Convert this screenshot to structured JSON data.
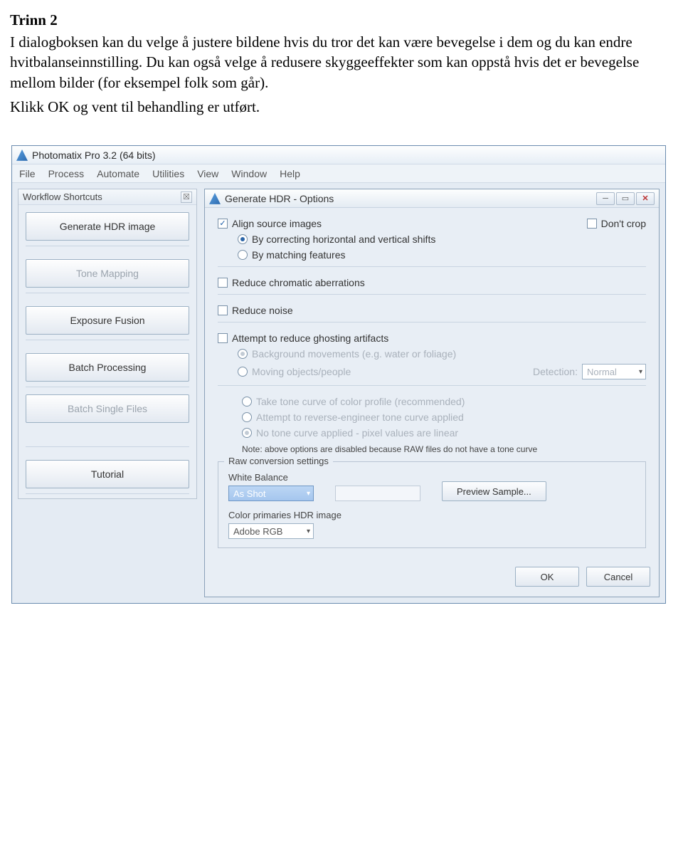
{
  "doc": {
    "heading": "Trinn 2",
    "para1": "I dialogboksen kan du velge å justere bildene hvis du tror det kan være bevegelse i dem og du kan endre hvitbalanseinnstilling. Du kan også velge å redusere skyggeeffekter som kan oppstå hvis det er bevegelse mellom bilder (for eksempel folk som går).",
    "para2": "Klikk OK og vent til behandling er utført."
  },
  "app": {
    "title": "Photomatix Pro 3.2 (64 bits)",
    "menu": [
      "File",
      "Process",
      "Automate",
      "Utilities",
      "View",
      "Window",
      "Help"
    ],
    "sidebar": {
      "panel_title": "Workflow Shortcuts",
      "buttons": {
        "generate": "Generate HDR image",
        "tonemap": "Tone Mapping",
        "exposure": "Exposure Fusion",
        "batch": "Batch Processing",
        "batch_single": "Batch Single Files",
        "tutorial": "Tutorial"
      }
    },
    "dialog": {
      "title": "Generate HDR - Options",
      "align": "Align source images",
      "dont_crop": "Don't crop",
      "align_opt1": "By correcting horizontal and vertical shifts",
      "align_opt2": "By matching features",
      "chroma": "Reduce chromatic aberrations",
      "noise": "Reduce noise",
      "ghost": "Attempt to reduce ghosting artifacts",
      "ghost_opt1": "Background movements (e.g. water or foliage)",
      "ghost_opt2": "Moving objects/people",
      "detection_label": "Detection:",
      "detection_value": "Normal",
      "tone1": "Take tone curve of color profile (recommended)",
      "tone2": "Attempt to reverse-engineer tone curve applied",
      "tone3": "No tone curve applied - pixel values are linear",
      "note": "Note: above options are disabled because RAW files do not have a tone curve",
      "raw": {
        "legend": "Raw conversion settings",
        "wb_label": "White Balance",
        "wb_value": "As Shot",
        "preview": "Preview Sample...",
        "cp_label": "Color primaries HDR image",
        "cp_value": "Adobe RGB"
      },
      "ok": "OK",
      "cancel": "Cancel"
    }
  }
}
